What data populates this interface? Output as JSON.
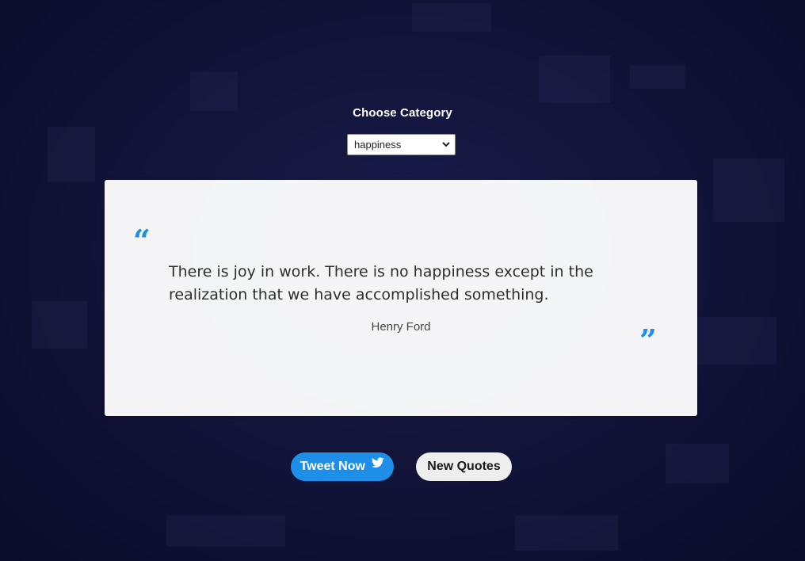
{
  "category": {
    "label": "Choose Category",
    "selected": "happiness"
  },
  "quote": {
    "text": "There is joy in work. There is no happiness except in the realization that we have accomplished something.",
    "author": "Henry Ford",
    "open_mark": "“",
    "close_mark": "”"
  },
  "actions": {
    "tweet_label": "Tweet Now",
    "new_label": "New Quotes"
  },
  "colors": {
    "accent": "#1d8fe8",
    "background": "#12143a",
    "card": "#ffffff"
  },
  "icons": {
    "tweet": "twitter-icon",
    "select": "chevron-down-icon"
  }
}
